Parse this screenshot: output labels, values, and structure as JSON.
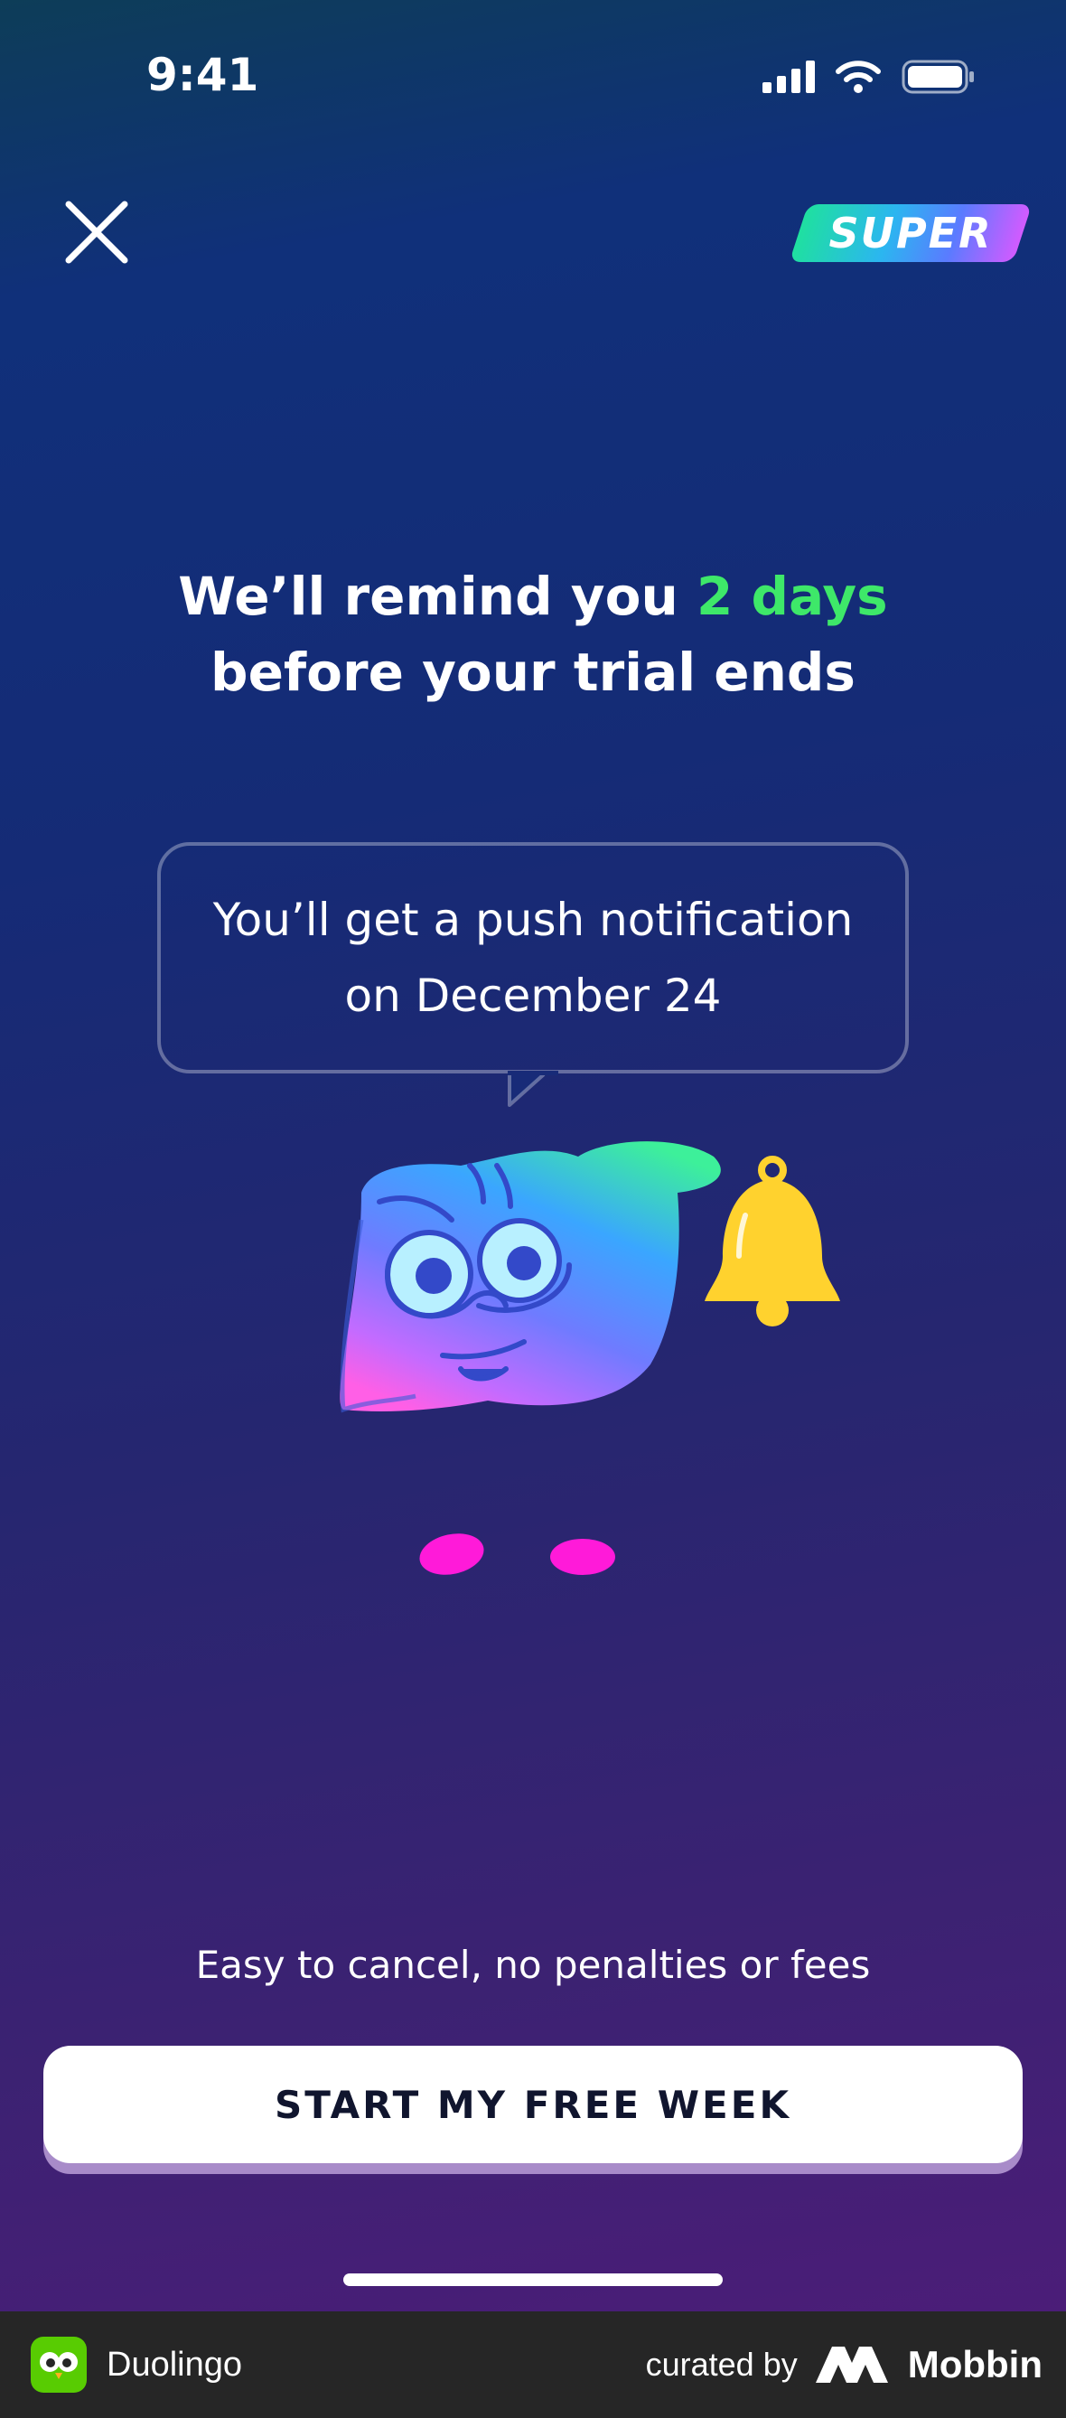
{
  "status_bar": {
    "time": "9:41"
  },
  "header": {
    "badge_label": "SUPER"
  },
  "headline": {
    "part1": "We’ll remind you ",
    "accent": "2 days",
    "part2": "before your trial ends"
  },
  "bubble": {
    "line1": "You’ll get a push notification",
    "line2": "on December 24"
  },
  "subtext": "Easy to cancel, no penalties or fees",
  "cta_label": "START MY FREE WEEK",
  "footer": {
    "app_name": "Duolingo",
    "curated_by": "curated by",
    "brand": "Mobbin"
  },
  "colors": {
    "accent_green": "#3ee869",
    "bell": "#ffd22e",
    "feet": "#ff1ad9"
  }
}
